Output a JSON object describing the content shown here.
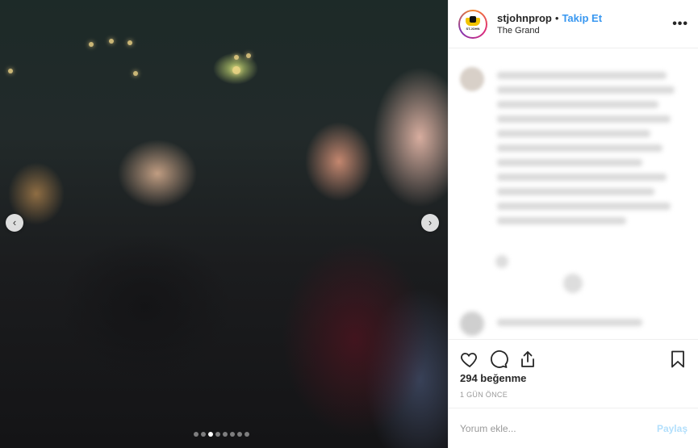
{
  "post": {
    "username": "stjohnprop",
    "separator": "•",
    "follow_label": "Takip Et",
    "location": "The Grand",
    "more_label": "•••",
    "avatar_text": "ST.JOHN"
  },
  "carousel": {
    "prev_label": "‹",
    "next_label": "›",
    "slide_count": 8,
    "active_index": 2
  },
  "actions": {
    "like_icon": "heart-icon",
    "comment_icon": "comment-icon",
    "share_icon": "share-icon",
    "save_icon": "bookmark-icon"
  },
  "likes_label": "294 beğenme",
  "timestamp": "1 GÜN ÖNCE",
  "comment_input": {
    "placeholder": "Yorum ekle..."
  },
  "post_button_label": "Paylaş",
  "colors": {
    "accent": "#3897f0",
    "post_disabled": "#b2dffc",
    "text": "#262626",
    "muted": "#999999"
  }
}
